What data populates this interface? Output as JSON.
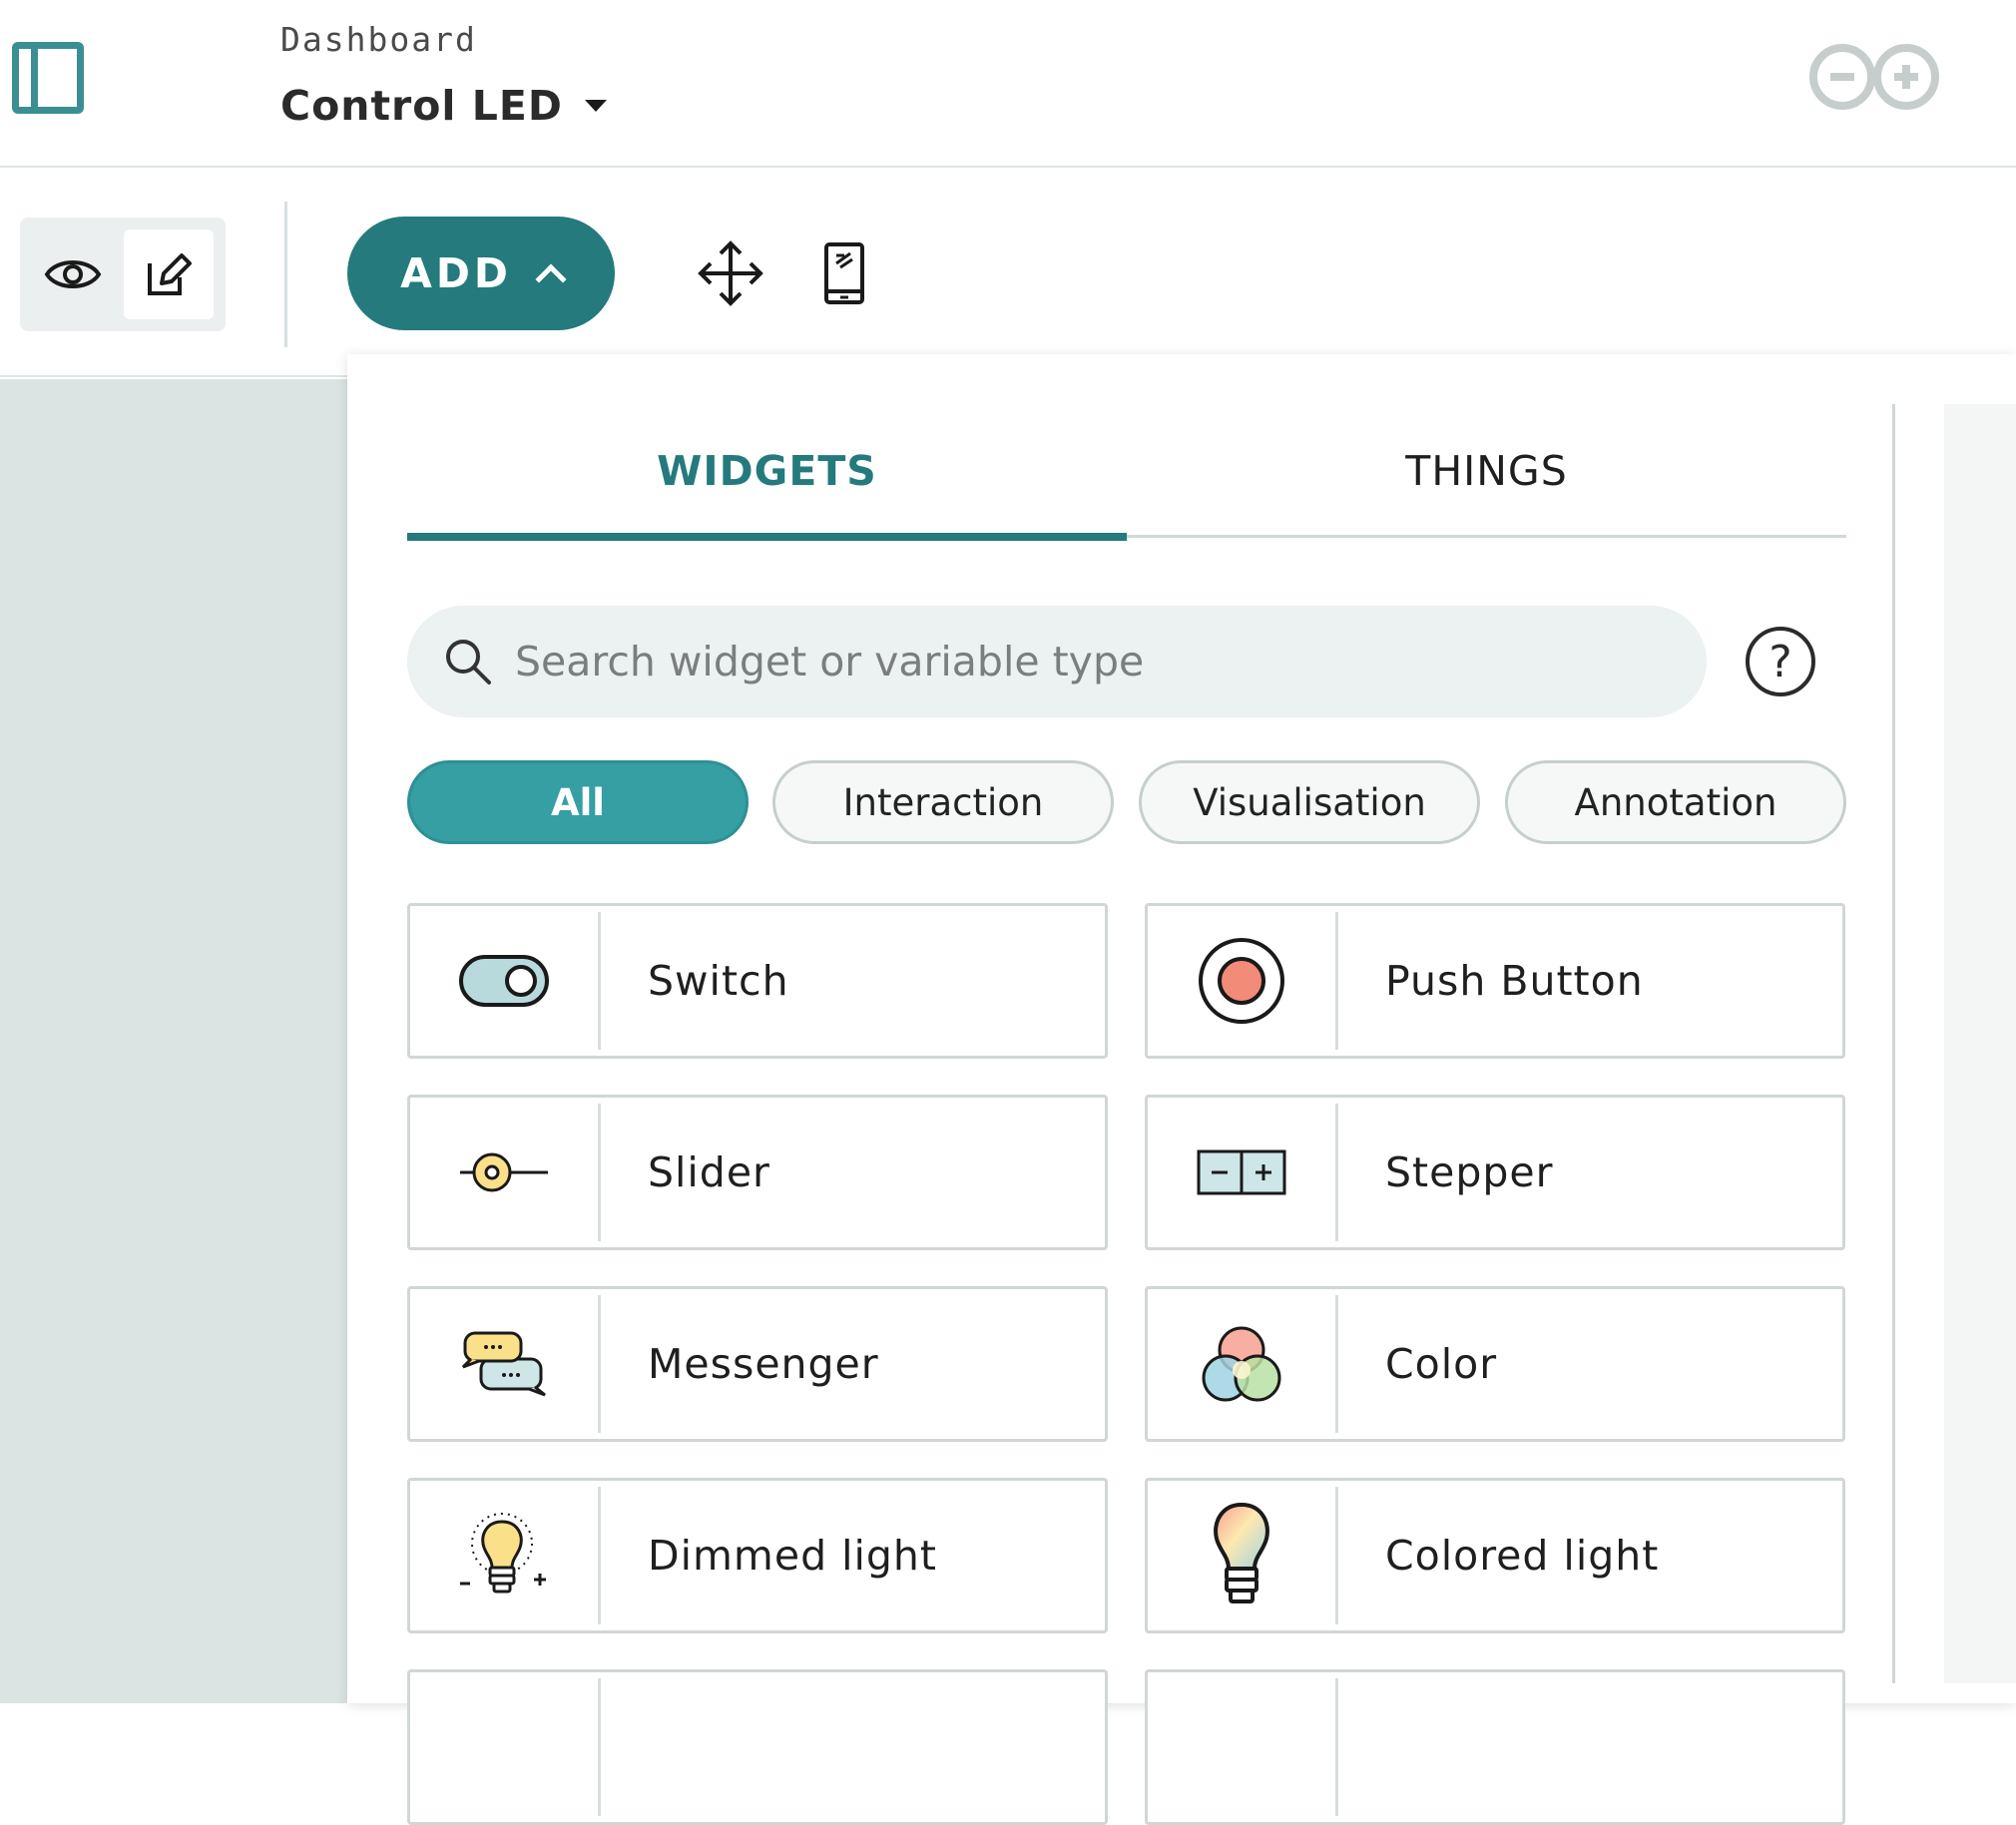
{
  "header": {
    "breadcrumb": "Dashboard",
    "title": "Control LED"
  },
  "toolbar": {
    "add_label": "ADD"
  },
  "panel": {
    "tabs": [
      {
        "label": "WIDGETS",
        "active": true
      },
      {
        "label": "THINGS",
        "active": false
      }
    ],
    "search": {
      "placeholder": "Search widget or variable type",
      "value": ""
    },
    "help_label": "?",
    "filters": [
      {
        "label": "All",
        "active": true
      },
      {
        "label": "Interaction",
        "active": false
      },
      {
        "label": "Visualisation",
        "active": false
      },
      {
        "label": "Annotation",
        "active": false
      }
    ],
    "widgets": [
      {
        "label": "Switch",
        "icon": "switch-icon"
      },
      {
        "label": "Push Button",
        "icon": "push-button-icon"
      },
      {
        "label": "Slider",
        "icon": "slider-icon"
      },
      {
        "label": "Stepper",
        "icon": "stepper-icon"
      },
      {
        "label": "Messenger",
        "icon": "messenger-icon"
      },
      {
        "label": "Color",
        "icon": "color-icon"
      },
      {
        "label": "Dimmed light",
        "icon": "dimmed-light-icon"
      },
      {
        "label": "Colored light",
        "icon": "colored-light-icon"
      }
    ]
  },
  "colors": {
    "accent": "#247a7d",
    "accent_light": "#359fa3",
    "canvas": "#dbe4e3"
  }
}
